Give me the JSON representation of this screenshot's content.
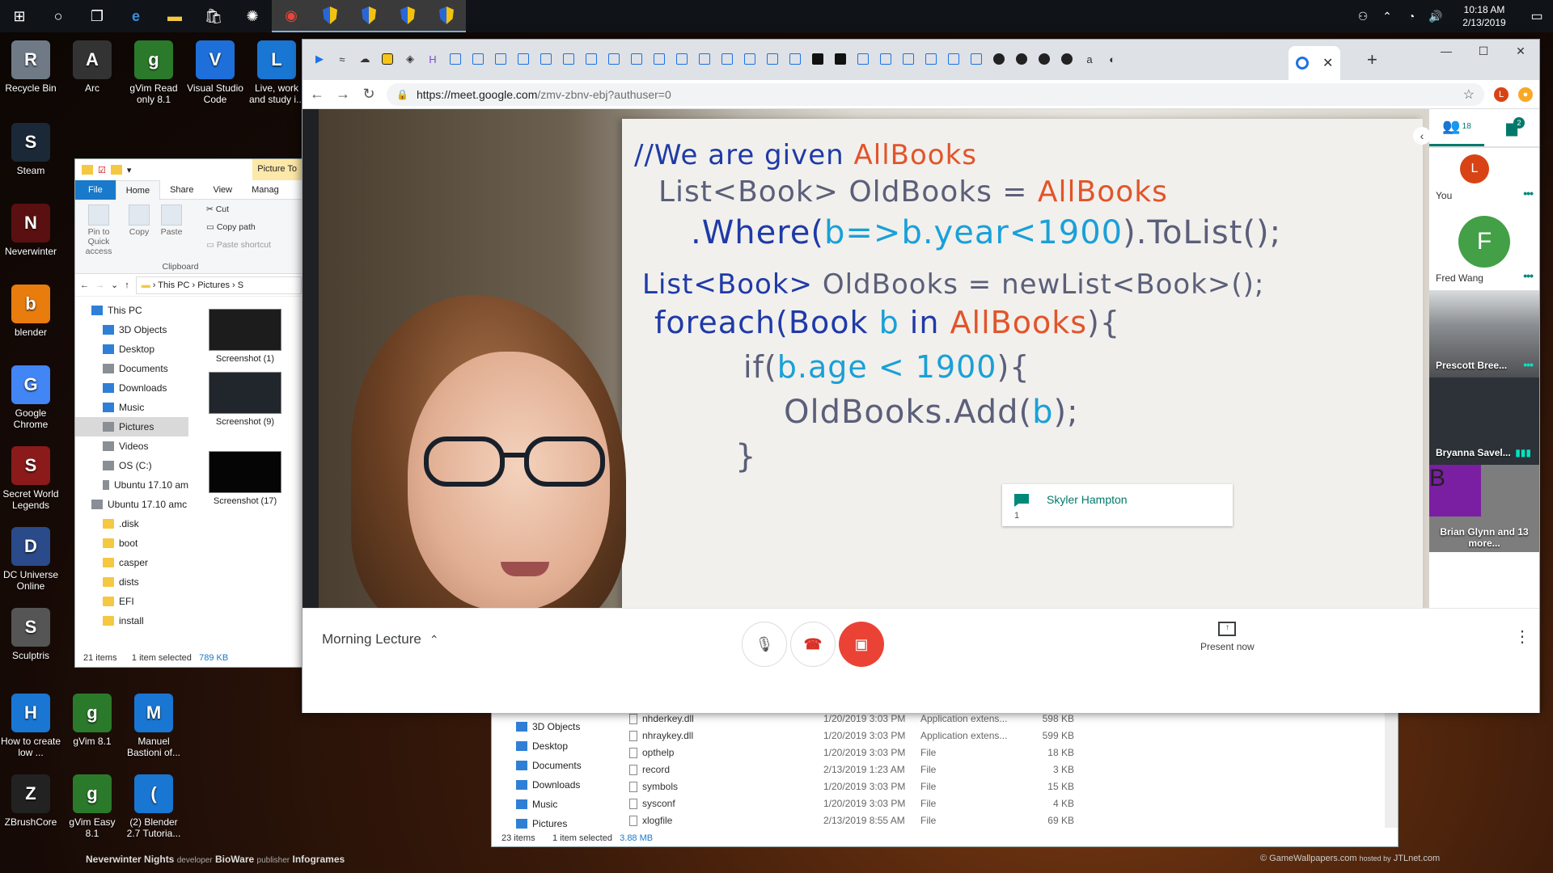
{
  "taskbar": {
    "clock_time": "10:18 AM",
    "clock_date": "2/13/2019"
  },
  "desktop_icons": [
    {
      "label": "Recycle Bin",
      "color": "#6f7a86"
    },
    {
      "label": "Arc",
      "color": "#333333"
    },
    {
      "label": "gVim Read only 8.1",
      "color": "#2b7a2b"
    },
    {
      "label": "Visual Studio Code",
      "color": "#1e6fd9"
    },
    {
      "label": "Live, work and study i...",
      "color": "#1976d2"
    },
    {
      "label": "Steam",
      "color": "#1b2838"
    },
    {
      "label": "Neverwinter",
      "color": "#5a1010"
    },
    {
      "label": "blender",
      "color": "#e87d0d"
    },
    {
      "label": "Google Chrome",
      "color": "#4285f4"
    },
    {
      "label": "Secret World Legends",
      "color": "#8b1a1a"
    },
    {
      "label": "DC Universe Online",
      "color": "#2a4a8a"
    },
    {
      "label": "Sculptris",
      "color": "#555555"
    },
    {
      "label": "How to create low ...",
      "color": "#1976d2"
    },
    {
      "label": "gVim 8.1",
      "color": "#2b7a2b"
    },
    {
      "label": "Manuel Bastioni of...",
      "color": "#1976d2"
    },
    {
      "label": "ZBrushCore",
      "color": "#222222"
    },
    {
      "label": "gVim Easy 8.1",
      "color": "#2b7a2b"
    },
    {
      "label": "(2) Blender 2.7 Tutoria...",
      "color": "#1976d2"
    }
  ],
  "explorer": {
    "picture_tools": "Picture To",
    "tabs": [
      "File",
      "Home",
      "Share",
      "View",
      "Manag"
    ],
    "ribbon": {
      "pin": "Pin to Quick access",
      "copy": "Copy",
      "paste": "Paste",
      "cut": "Cut",
      "copy_path": "Copy path",
      "paste_shortcut": "Paste shortcut",
      "group": "Clipboard"
    },
    "path": [
      "This PC",
      "Pictures",
      "S"
    ],
    "nav": [
      {
        "label": "This PC",
        "icon": "pc"
      },
      {
        "label": "3D Objects",
        "icon": "blue"
      },
      {
        "label": "Desktop",
        "icon": "blue"
      },
      {
        "label": "Documents",
        "icon": "grey"
      },
      {
        "label": "Downloads",
        "icon": "blue"
      },
      {
        "label": "Music",
        "icon": "blue"
      },
      {
        "label": "Pictures",
        "icon": "grey"
      },
      {
        "label": "Videos",
        "icon": "grey"
      },
      {
        "label": "OS (C:)",
        "icon": "grey"
      },
      {
        "label": "Ubuntu 17.10 am",
        "icon": "grey"
      },
      {
        "label": "Ubuntu 17.10 amc",
        "icon": "grey"
      },
      {
        "label": ".disk",
        "icon": "folder"
      },
      {
        "label": "boot",
        "icon": "folder"
      },
      {
        "label": "casper",
        "icon": "folder"
      },
      {
        "label": "dists",
        "icon": "folder"
      },
      {
        "label": "EFI",
        "icon": "folder"
      },
      {
        "label": "install",
        "icon": "folder"
      }
    ],
    "thumbnails": [
      "Screenshot (1)",
      "Screenshot (9)",
      "Screenshot (17)"
    ],
    "status_items": "21 items",
    "status_selected": "1 item selected",
    "status_size": "789 KB"
  },
  "explorer2": {
    "nav": [
      "3D Objects",
      "Desktop",
      "Documents",
      "Downloads",
      "Music",
      "Pictures"
    ],
    "files": [
      {
        "name": "nhderkey.dll",
        "date": "1/20/2019 3:03 PM",
        "type": "Application extens...",
        "size": "598 KB"
      },
      {
        "name": "nhraykey.dll",
        "date": "1/20/2019 3:03 PM",
        "type": "Application extens...",
        "size": "599 KB"
      },
      {
        "name": "opthelp",
        "date": "1/20/2019 3:03 PM",
        "type": "File",
        "size": "18 KB"
      },
      {
        "name": "record",
        "date": "2/13/2019 1:23 AM",
        "type": "File",
        "size": "3 KB"
      },
      {
        "name": "symbols",
        "date": "1/20/2019 3:03 PM",
        "type": "File",
        "size": "15 KB"
      },
      {
        "name": "sysconf",
        "date": "1/20/2019 3:03 PM",
        "type": "File",
        "size": "4 KB"
      },
      {
        "name": "xlogfile",
        "date": "2/13/2019 8:55 AM",
        "type": "File",
        "size": "69 KB"
      }
    ],
    "status_items": "23 items",
    "status_selected": "1 item selected",
    "status_size": "3.88 MB"
  },
  "chrome": {
    "url_domain": "https://meet.google.com",
    "url_rest": "/zmv-zbnv-ebj?authuser=0",
    "profile_letter": "L",
    "profile_color": "#d84315",
    "ext_color": "#f9a825"
  },
  "whiteboard": {
    "line1_a": "//We are given",
    "line1_b": "AllBooks",
    "line2_a": "List<Book>",
    "line2_b": "OldBooks =",
    "line2_c": "AllBooks",
    "line3_a": ".Where(",
    "line3_b": "b=>b.year<1900",
    "line3_c": ").ToList();",
    "line4_a": "List<Book>",
    "line4_b": "OldBooks = newList<Book>();",
    "line5_a": "foreach(Book",
    "line5_b": "b",
    "line5_c": "in",
    "line5_d": "AllBooks",
    "line5_e": "){",
    "line6_a": "if(",
    "line6_b": "b.age < 1900",
    "line6_c": "){",
    "line7_a": "OldBooks.Add(",
    "line7_b": "b",
    "line7_c": ");",
    "line8": "}"
  },
  "meet": {
    "caption_name": "Skyler Hampton",
    "caption_text": "1",
    "people_count": "18",
    "chat_count": "2",
    "participants": [
      {
        "name": "You",
        "initial": "L",
        "color": "#d84315"
      },
      {
        "name": "Fred Wang",
        "initial": "F",
        "color": "#43a047"
      },
      {
        "name": "Prescott Bree...",
        "initial": "",
        "color": "#6a6a6a"
      },
      {
        "name": "Bryanna Savel...",
        "initial": "",
        "color": "#2c3238"
      },
      {
        "name": "Brian Glynn and 13 more...",
        "initial": "B",
        "color": "#7b1fa2"
      }
    ],
    "meeting_title": "Morning Lecture",
    "present_label": "Present now"
  },
  "watermark_left": {
    "title": "Neverwinter Nights",
    "dev_label": "developer",
    "dev": "BioWare",
    "pub_label": "publisher",
    "pub": "Infogrames"
  },
  "watermark_right": {
    "site": "© GameWallpapers.com",
    "hosted": "hosted by",
    "host": "JTLnet.com"
  }
}
